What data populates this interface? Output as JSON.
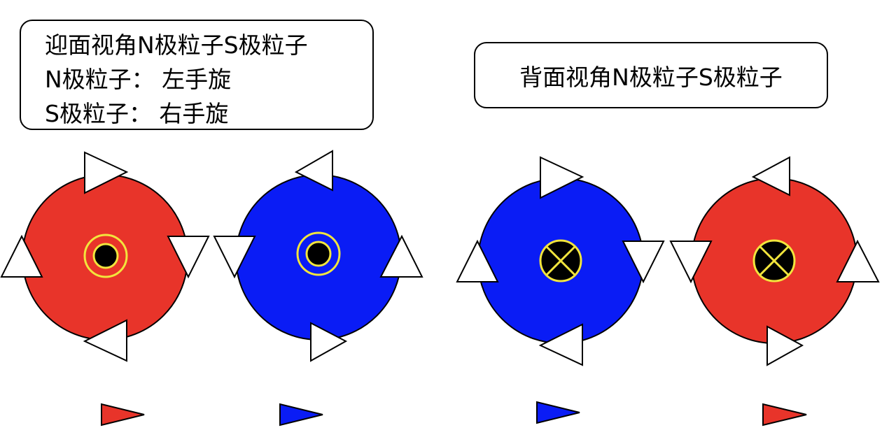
{
  "front_box": {
    "line1": "迎面视角N极粒子S极粒子",
    "line2": "N极粒子：  左手旋",
    "line3": "S极粒子：  右手旋"
  },
  "back_box": {
    "title": "背面视角N极粒子S极粒子"
  },
  "colors": {
    "red": "#E8342A",
    "blue": "#0A1CF5",
    "ring": "#F2E53D",
    "core": "#000000",
    "arrow": "#FFFFFF"
  }
}
